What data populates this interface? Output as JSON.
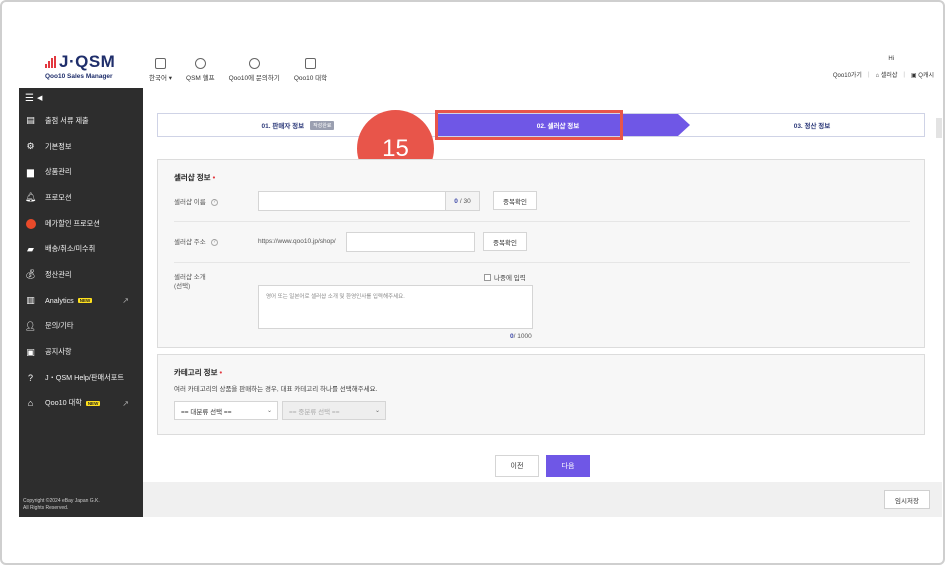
{
  "logo": {
    "name": "J·QSM",
    "sub": "Qoo10 Sales Manager"
  },
  "topnav": [
    {
      "label": "한국어 ▾",
      "icon": "translate-icon"
    },
    {
      "label": "QSM 헬프",
      "icon": "help-icon"
    },
    {
      "label": "Qoo10에 문의하기",
      "icon": "chat-icon"
    },
    {
      "label": "Qoo10 대학",
      "icon": "school-icon"
    }
  ],
  "topright": {
    "greeting": "Hi",
    "links": [
      "Qoo10가기",
      "셀러샵",
      "Q캐시"
    ]
  },
  "sidebar": {
    "items": [
      {
        "label": "출점 서류 제출",
        "icon": "document-icon"
      },
      {
        "label": "기본정보",
        "icon": "gear-icon"
      },
      {
        "label": "상품관리",
        "icon": "file-icon"
      },
      {
        "label": "프로모션",
        "icon": "bell-icon"
      },
      {
        "label": "메가할인 프로모션",
        "icon": "mega-icon"
      },
      {
        "label": "배송/취소/미수취",
        "icon": "truck-icon"
      },
      {
        "label": "정산관리",
        "icon": "money-bag-icon"
      },
      {
        "label": "Analytics",
        "icon": "chart-icon",
        "new": "NEW",
        "external": true
      },
      {
        "label": "문의/기타",
        "icon": "person-icon"
      },
      {
        "label": "공지사항",
        "icon": "notice-icon"
      },
      {
        "label": "J・QSM Help/판매서포트",
        "icon": "question-icon"
      },
      {
        "label": "Qoo10 대학",
        "icon": "school-icon",
        "new": "NEW",
        "external": true
      }
    ],
    "copyright_line1": "Copyright ©2024 eBay Japan G.K.",
    "copyright_line2": "All Rights Reserved."
  },
  "stepper": {
    "step1": "01. 판매자 정보",
    "step1_badge": "작성완료",
    "step2": "02. 셀러샵 정보",
    "step3": "03. 정산 정보"
  },
  "annotation": {
    "number": "15"
  },
  "shop": {
    "title": "셀러샵 정보",
    "req": "•",
    "name_label": "셀러샵 이름",
    "name_count": "0",
    "name_max": "/ 30",
    "dup_check": "중복확인",
    "addr_label": "셀러샵 주소",
    "addr_prefix": "https://www.qoo10.jp/shop/",
    "intro_label_1": "셀러샵 소개",
    "intro_label_2": "(선택)",
    "later_input": "나중에 입력",
    "intro_placeholder": "영어 또는 일본어로 셀러샵 소개 및 환영인사를 입력해주세요.",
    "intro_count": "0",
    "intro_max": "/ 1000"
  },
  "category": {
    "title": "카테고리 정보",
    "req": "•",
    "desc": "여러 카테고리의 상품을 판매하는 경우, 대표 카테고리 하나를 선택해주세요.",
    "main_select": "== 대분류 선택 ==",
    "sub_select": "== 중분류 선택 =="
  },
  "nav": {
    "prev": "이전",
    "next": "다음"
  },
  "footer": {
    "temp_save": "임시저장"
  }
}
